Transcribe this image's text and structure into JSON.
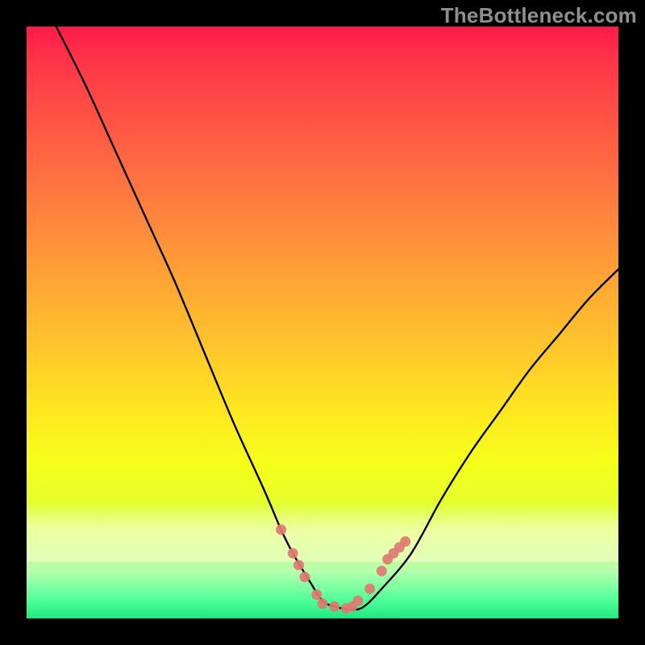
{
  "watermark": "TheBottleneck.com",
  "colors": {
    "frame": "#000000",
    "curve": "#000000",
    "markers": "#e07a72",
    "gradient_top": "#ff1a49",
    "gradient_bottom": "#20e87e",
    "cream_band": "#fffed2"
  },
  "chart_data": {
    "type": "line",
    "title": "",
    "xlabel": "",
    "ylabel": "",
    "xlim": [
      0,
      100
    ],
    "ylim": [
      0,
      100
    ],
    "grid": false,
    "legend": false,
    "series": [
      {
        "name": "bottleneck-curve",
        "x": [
          5,
          10,
          15,
          20,
          25,
          30,
          35,
          40,
          43,
          45,
          48,
          50,
          52,
          55,
          57,
          60,
          65,
          70,
          75,
          80,
          85,
          90,
          95,
          100
        ],
        "y": [
          100,
          90,
          79,
          68,
          57,
          45,
          33,
          22,
          15,
          11,
          6,
          3,
          2,
          1.5,
          2,
          5,
          11,
          20,
          28,
          35,
          42,
          48,
          54,
          59
        ]
      }
    ],
    "markers": {
      "name": "highlighted-points",
      "points": [
        {
          "x": 43,
          "y": 15
        },
        {
          "x": 45,
          "y": 11
        },
        {
          "x": 46,
          "y": 9
        },
        {
          "x": 47,
          "y": 7
        },
        {
          "x": 49,
          "y": 4
        },
        {
          "x": 50,
          "y": 2.5
        },
        {
          "x": 52,
          "y": 2
        },
        {
          "x": 54,
          "y": 1.7
        },
        {
          "x": 55,
          "y": 2
        },
        {
          "x": 56,
          "y": 3
        },
        {
          "x": 58,
          "y": 5
        },
        {
          "x": 60,
          "y": 8
        },
        {
          "x": 61,
          "y": 10
        },
        {
          "x": 62,
          "y": 11
        },
        {
          "x": 63,
          "y": 12
        },
        {
          "x": 64,
          "y": 13
        }
      ]
    }
  }
}
